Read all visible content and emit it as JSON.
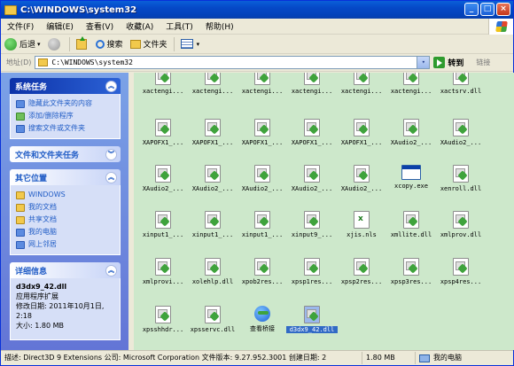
{
  "window": {
    "title": "C:\\WINDOWS\\system32",
    "buttons": {
      "minimize": "_",
      "maximize": "□",
      "close": "×"
    }
  },
  "menu": [
    "文件(F)",
    "编辑(E)",
    "查看(V)",
    "收藏(A)",
    "工具(T)",
    "帮助(H)"
  ],
  "toolbar": {
    "back": "后退",
    "search": "搜索",
    "folders": "文件夹",
    "back_drop": "▾",
    "views_drop": "▾"
  },
  "address": {
    "label": "地址(D)",
    "value": "C:\\WINDOWS\\system32",
    "drop": "▾",
    "go": "转到",
    "links": "链接"
  },
  "left_panel": {
    "system_tasks": {
      "title": "系统任务",
      "chevron": "︽",
      "items": [
        "隐藏此文件夹的内容",
        "添加/删除程序",
        "搜索文件或文件夹"
      ]
    },
    "file_tasks": {
      "title": "文件和文件夹任务",
      "chevron": "︾"
    },
    "other_places": {
      "title": "其它位置",
      "chevron": "︽",
      "items": [
        "WINDOWS",
        "我的文档",
        "共享文档",
        "我的电脑",
        "网上邻居"
      ]
    },
    "details": {
      "title": "详细信息",
      "chevron": "︽",
      "name": "d3dx9_42.dll",
      "type": "应用程序扩展",
      "modified_label": "修改日期:",
      "modified_value": "2011年10月1日, 2:18",
      "size": "大小: 1.80 MB"
    }
  },
  "files": [
    {
      "name": "xactengi...",
      "icon": "dll",
      "row": 0,
      "col": 0
    },
    {
      "name": "xactengi...",
      "icon": "dll",
      "row": 0,
      "col": 1
    },
    {
      "name": "xactengi...",
      "icon": "dll",
      "row": 0,
      "col": 2
    },
    {
      "name": "xactengi...",
      "icon": "dll",
      "row": 0,
      "col": 3
    },
    {
      "name": "xactengi...",
      "icon": "dll",
      "row": 0,
      "col": 4
    },
    {
      "name": "xactengi...",
      "icon": "dll",
      "row": 0,
      "col": 5
    },
    {
      "name": "xactsrv.dll",
      "icon": "dll",
      "row": 0,
      "col": 6
    },
    {
      "name": "XAPOFX1_...",
      "icon": "dll",
      "row": 1,
      "col": 0
    },
    {
      "name": "XAPOFX1_...",
      "icon": "dll",
      "row": 1,
      "col": 1
    },
    {
      "name": "XAPOFX1_...",
      "icon": "dll",
      "row": 1,
      "col": 2
    },
    {
      "name": "XAPOFX1_...",
      "icon": "dll",
      "row": 1,
      "col": 3
    },
    {
      "name": "XAPOFX1_...",
      "icon": "dll",
      "row": 1,
      "col": 4
    },
    {
      "name": "XAudio2_...",
      "icon": "dll",
      "row": 1,
      "col": 5
    },
    {
      "name": "XAudio2_...",
      "icon": "dll",
      "row": 1,
      "col": 6
    },
    {
      "name": "XAudio2_...",
      "icon": "dll",
      "row": 2,
      "col": 0
    },
    {
      "name": "XAudio2_...",
      "icon": "dll",
      "row": 2,
      "col": 1
    },
    {
      "name": "XAudio2_...",
      "icon": "dll",
      "row": 2,
      "col": 2
    },
    {
      "name": "XAudio2_...",
      "icon": "dll",
      "row": 2,
      "col": 3
    },
    {
      "name": "XAudio2_...",
      "icon": "dll",
      "row": 2,
      "col": 4
    },
    {
      "name": "xcopy.exe",
      "icon": "exe",
      "row": 2,
      "col": 5
    },
    {
      "name": "xenroll.dll",
      "icon": "dll",
      "row": 2,
      "col": 6
    },
    {
      "name": "xinput1_...",
      "icon": "dll",
      "row": 3,
      "col": 0
    },
    {
      "name": "xinput1_...",
      "icon": "dll",
      "row": 3,
      "col": 1
    },
    {
      "name": "xinput1_...",
      "icon": "dll",
      "row": 3,
      "col": 2
    },
    {
      "name": "xinput9_...",
      "icon": "dll",
      "row": 3,
      "col": 3
    },
    {
      "name": "xjis.nls",
      "icon": "xls",
      "row": 3,
      "col": 4
    },
    {
      "name": "xmllite.dll",
      "icon": "dll",
      "row": 3,
      "col": 5
    },
    {
      "name": "xmlprov.dll",
      "icon": "dll",
      "row": 3,
      "col": 6
    },
    {
      "name": "xmlprovi...",
      "icon": "dll",
      "row": 4,
      "col": 0
    },
    {
      "name": "xolehlp.dll",
      "icon": "dll",
      "row": 4,
      "col": 1
    },
    {
      "name": "xpob2res...",
      "icon": "dll",
      "row": 4,
      "col": 2
    },
    {
      "name": "xpsp1res...",
      "icon": "dll",
      "row": 4,
      "col": 3
    },
    {
      "name": "xpsp2res...",
      "icon": "dll",
      "row": 4,
      "col": 4
    },
    {
      "name": "xpsp3res...",
      "icon": "dll",
      "row": 4,
      "col": 5
    },
    {
      "name": "xpsp4res...",
      "icon": "dll",
      "row": 4,
      "col": 6
    },
    {
      "name": "xpsshhdr...",
      "icon": "dll",
      "row": 5,
      "col": 0
    },
    {
      "name": "xpsservc.dll",
      "icon": "dll",
      "row": 5,
      "col": 1
    },
    {
      "name": "查看桥接",
      "icon": "globe",
      "row": 5,
      "col": 2
    },
    {
      "name": "d3dx9_42.dll",
      "icon": "dll",
      "row": 5,
      "col": 3,
      "selected": true
    }
  ],
  "status": {
    "description": "描述: Direct3D 9 Extensions 公司: Microsoft Corporation 文件版本: 9.27.952.3001 创建日期: 2",
    "size": "1.80 MB",
    "location": "我的电脑"
  }
}
